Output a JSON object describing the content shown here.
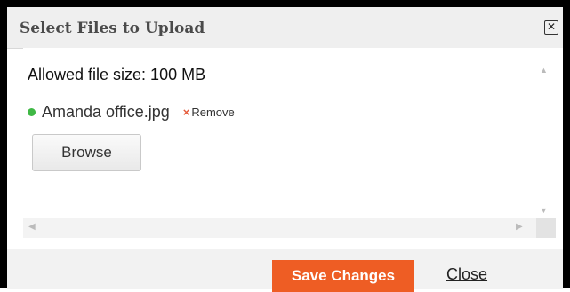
{
  "dialog": {
    "title": "Select Files to Upload",
    "close_icon": "☒"
  },
  "upload": {
    "allowed_size_label": "Allowed file size: 100 MB",
    "files": [
      {
        "name": "Amanda office.jpg",
        "status_color": "#3fb845",
        "remove_label": "Remove",
        "remove_icon": "×"
      }
    ],
    "browse_label": "Browse"
  },
  "footer": {
    "save_label": "Save Changes",
    "close_label": "Close"
  },
  "colors": {
    "accent": "#ee5d24",
    "remove_x": "#e55a3a"
  }
}
